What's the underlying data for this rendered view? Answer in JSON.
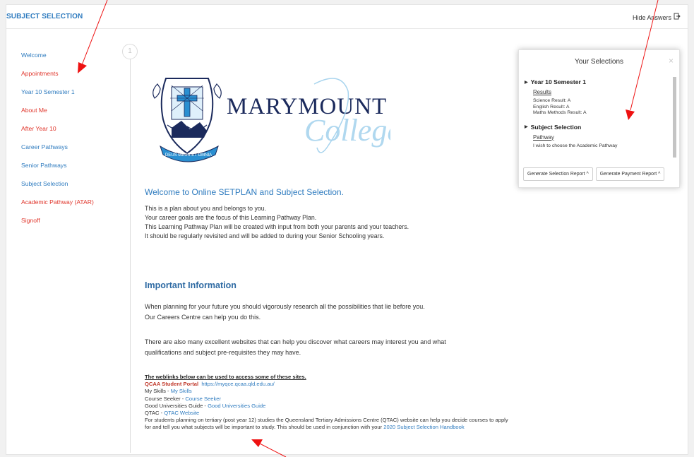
{
  "header": {
    "title": "SUBJECT SELECTION",
    "hide_answers": "Hide Answers"
  },
  "sidebar": {
    "items": [
      {
        "label": "Welcome",
        "color": "#2e7bbf"
      },
      {
        "label": "Appointments",
        "color": "#e0362c"
      },
      {
        "label": "Year 10 Semester 1",
        "color": "#2e7bbf"
      },
      {
        "label": "About Me",
        "color": "#e0362c"
      },
      {
        "label": "After Year 10",
        "color": "#e0362c"
      },
      {
        "label": "Career Pathways",
        "color": "#2e7bbf"
      },
      {
        "label": "Senior Pathways",
        "color": "#2e7bbf"
      },
      {
        "label": "Subject Selection",
        "color": "#2e7bbf"
      },
      {
        "label": "Academic Pathway (ATAR)",
        "color": "#e0362c"
      },
      {
        "label": "Signoff",
        "color": "#e0362c"
      }
    ]
  },
  "timeline": {
    "step": "1"
  },
  "logo": {
    "name": "MARYMOUNT",
    "script": "College",
    "motto": "DEUS MEUS ET OMNIA"
  },
  "main": {
    "welcome_title": "Welcome to Online SETPLAN and Subject Selection.",
    "intro_lines": [
      "This is a plan about you and belongs to you.",
      "Your career goals are the focus of this Learning Pathway Plan.",
      "This Learning Pathway Plan will be created with input from both your parents and your teachers.",
      "It should be regularly revisited and will be added to during your Senior Schooling years."
    ],
    "info_title": "Important Information",
    "para1": [
      "When planning for your future you should vigorously research all the possibilities that lie before you.",
      "Our Careers Centre can help you do this."
    ],
    "para2": [
      "There are also many excellent websites that can help you discover what careers may interest you and what",
      "qualifications and subject pre-requisites they may have."
    ],
    "links": {
      "heading": "The weblinks below can be used to access some of these sites.",
      "qcaa_label": "QCAA Student Portal",
      "qcaa_url": "https://myqce.qcaa.qld.edu.au/",
      "myskills_prefix": "My Skills - ",
      "myskills_link": "My Skills",
      "courseseeker_prefix": "Course Seeker - ",
      "courseseeker_link": "Course Seeker",
      "gug_prefix": "Good Universities Guide - ",
      "gug_link": "Good Universities Guide",
      "qtac_prefix": "QTAC - ",
      "qtac_link": "QTAC Website",
      "tertiary_text": "For students planning on tertiary (post year 12) studies the Queensland Tertiary Admissions Centre (QTAC) website can help you decide courses to apply for and tell you what subjects will be important to study. This should be used in conjunction with your ",
      "handbook_link": "2020 Subject Selection Handbook"
    }
  },
  "panel": {
    "title": "Your Selections",
    "close": "×",
    "sections": [
      {
        "title": "Year 10 Semester 1",
        "sub": "Results",
        "lines": [
          "Science Result: A",
          "English Result: A",
          "Maths Methods Result: A"
        ]
      },
      {
        "title": "Subject Selection",
        "sub": "Pathway",
        "lines": [
          "I wish to choose the Academic Pathway"
        ]
      }
    ],
    "buttons": [
      "Generate Selection Report ^",
      "Generate Payment Report ^"
    ]
  }
}
